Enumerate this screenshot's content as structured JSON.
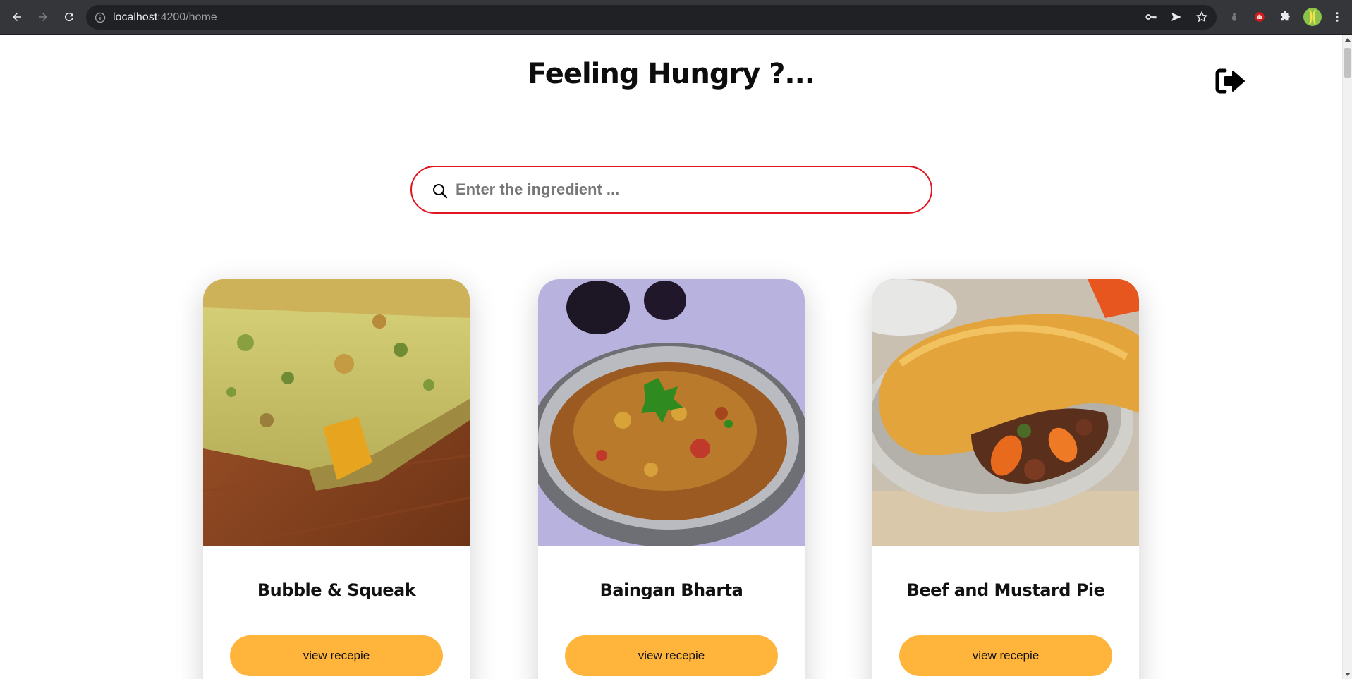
{
  "browser": {
    "url_host": "localhost",
    "url_path": ":4200/home"
  },
  "page": {
    "title": "Feeling Hungry ?...",
    "search": {
      "placeholder": "Enter the ingredient ...",
      "value": ""
    },
    "recipes": [
      {
        "name": "Bubble & Squeak",
        "button_label": "view recepie",
        "photo": "bubble-and-squeak-photo"
      },
      {
        "name": "Baingan Bharta",
        "button_label": "view recepie",
        "photo": "baingan-bharta-photo"
      },
      {
        "name": "Beef and Mustard Pie",
        "button_label": "view recepie",
        "photo": "beef-and-mustard-pie-photo"
      }
    ]
  },
  "colors": {
    "search_border": "#e0151f",
    "button": "#ffb43c",
    "chrome_bg": "#35363a",
    "omnibox_bg": "#202124"
  }
}
